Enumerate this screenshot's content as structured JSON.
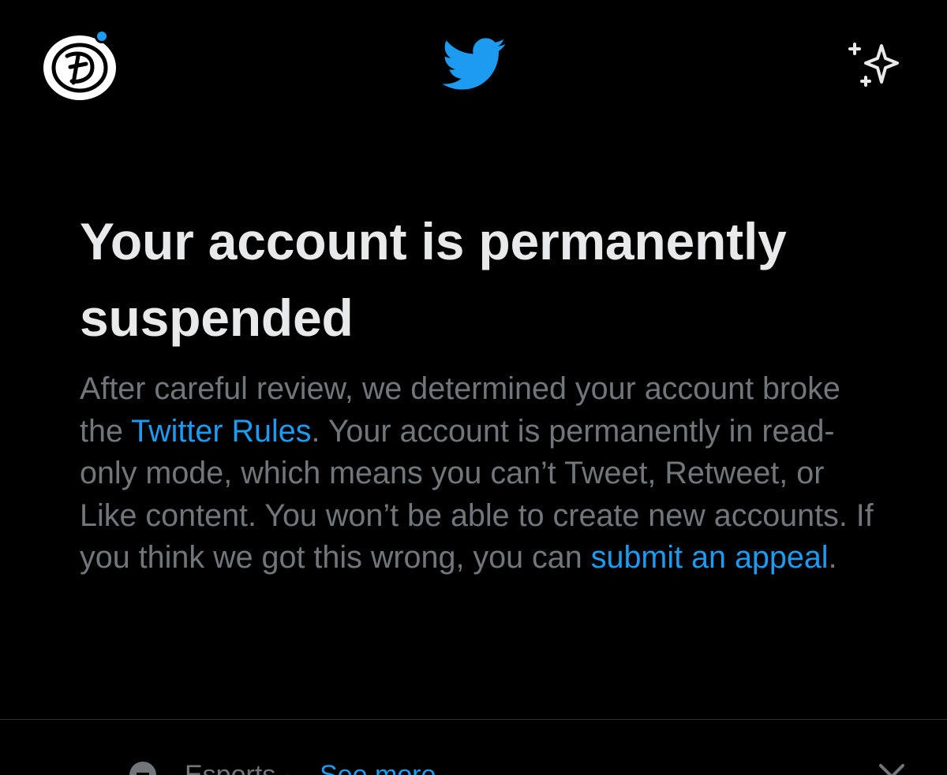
{
  "header": {
    "avatar_icon": "profile-avatar",
    "logo_icon": "twitter-bird-icon",
    "sparkle_icon": "sparkle-icon",
    "brand_color": "#1d9bf0"
  },
  "main": {
    "title": "Your account is permanently suspended",
    "body_before_rules": "After careful review, we determined your account broke the ",
    "rules_link": "Twitter Rules",
    "body_middle": ". Your account is permanently in read-only mode, which means you can’t Tweet, Retweet, or Like content. You won’t be able to create new accounts. If you think we got this wrong, you can ",
    "appeal_link": "submit an appeal",
    "body_end": "."
  },
  "bottom_row": {
    "label": "Esports",
    "separator": "·",
    "link": "See more"
  },
  "colors": {
    "background": "#000000",
    "title": "#e7e9ea",
    "body": "#71767b",
    "link": "#1d9bf0"
  }
}
